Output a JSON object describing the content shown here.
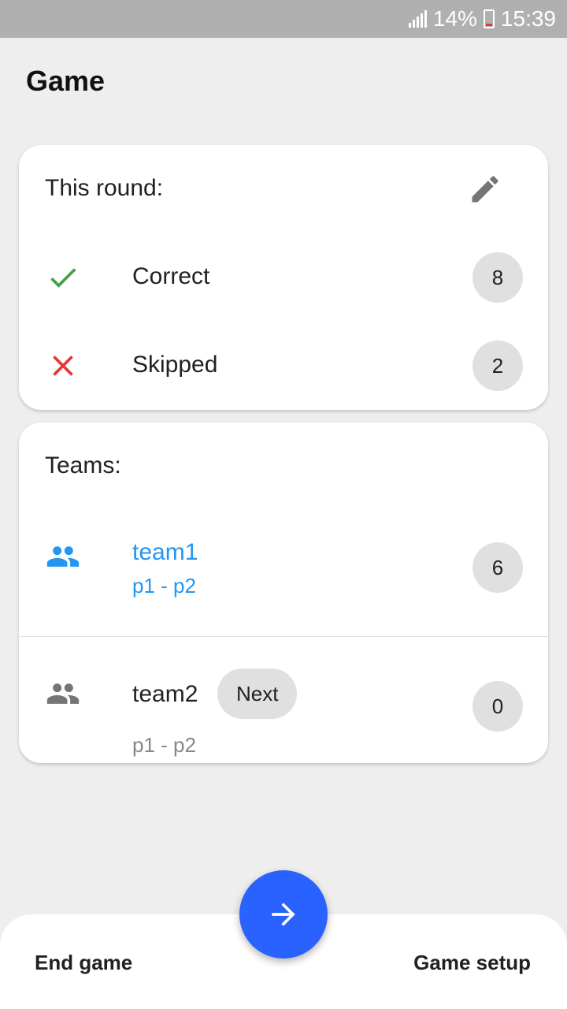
{
  "status_bar": {
    "battery": "14%",
    "time": "15:39"
  },
  "page": {
    "title": "Game"
  },
  "round": {
    "heading": "This round:",
    "rows": [
      {
        "label": "Correct",
        "count": "8",
        "icon": "check-icon",
        "color": "#43a047"
      },
      {
        "label": "Skipped",
        "count": "2",
        "icon": "close-icon",
        "color": "#e53935"
      }
    ]
  },
  "teams": {
    "heading": "Teams:",
    "list": [
      {
        "name": "team1",
        "players": "p1 - p2",
        "score": "6",
        "active": true,
        "icon": "group-icon"
      },
      {
        "name": "team2",
        "players": "p1 - p2",
        "score": "0",
        "active": false,
        "badge": "Next",
        "icon": "group-icon"
      }
    ]
  },
  "bottom_bar": {
    "left_label": "End game",
    "right_label": "Game setup",
    "fab_icon": "arrow-right-icon"
  },
  "colors": {
    "accent": "#2196f3",
    "fab": "#2962ff",
    "correct": "#43a047",
    "skipped": "#e53935"
  }
}
